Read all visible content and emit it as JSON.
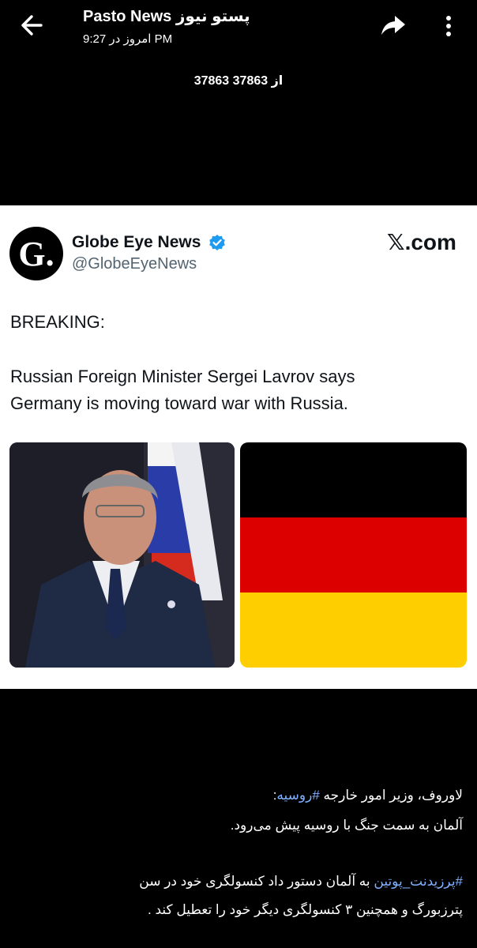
{
  "header": {
    "title": "Pasto News پستو نیوز",
    "subtitle": "امروز در 9:27 PM",
    "counter": "37863 از 37863"
  },
  "tweet": {
    "author_name": "Globe Eye News",
    "handle": "@GlobeEyeNews",
    "site": ".com",
    "site_x": "𝕏",
    "avatar_letter": "G.",
    "breaking": "BREAKING:",
    "body_line1": "Russian Foreign Minister Sergei Lavrov says",
    "body_line2": "Germany is moving toward war with Russia."
  },
  "description": {
    "line1_pre": "لاوروف، وزیر امور خارجه ",
    "line1_tag": "#روسیه",
    "line1_post": ":",
    "line2": "آلمان به سمت جنگ با روسیه پیش می‌رود.",
    "line3_tag": "#پرزیدنت_پوتین",
    "line3_post": "  به آلمان دستور داد کنسولگری خود در سن",
    "line4": "پترزبورگ و همچنین ۳ کنسولگری دیگر  خود را تعطیل کند ."
  },
  "colors": {
    "link": "#7fb0ff",
    "verified": "#1d9bf0",
    "flag_black": "#000000",
    "flag_red": "#dd0000",
    "flag_gold": "#ffce00",
    "russian_flag_blue": "#2a3ca8",
    "russian_flag_red": "#d52b1e"
  },
  "icons": {
    "back": "arrow-left-icon",
    "share": "share-arrow-icon",
    "more": "more-vertical-icon",
    "verified": "verified-badge-icon"
  }
}
